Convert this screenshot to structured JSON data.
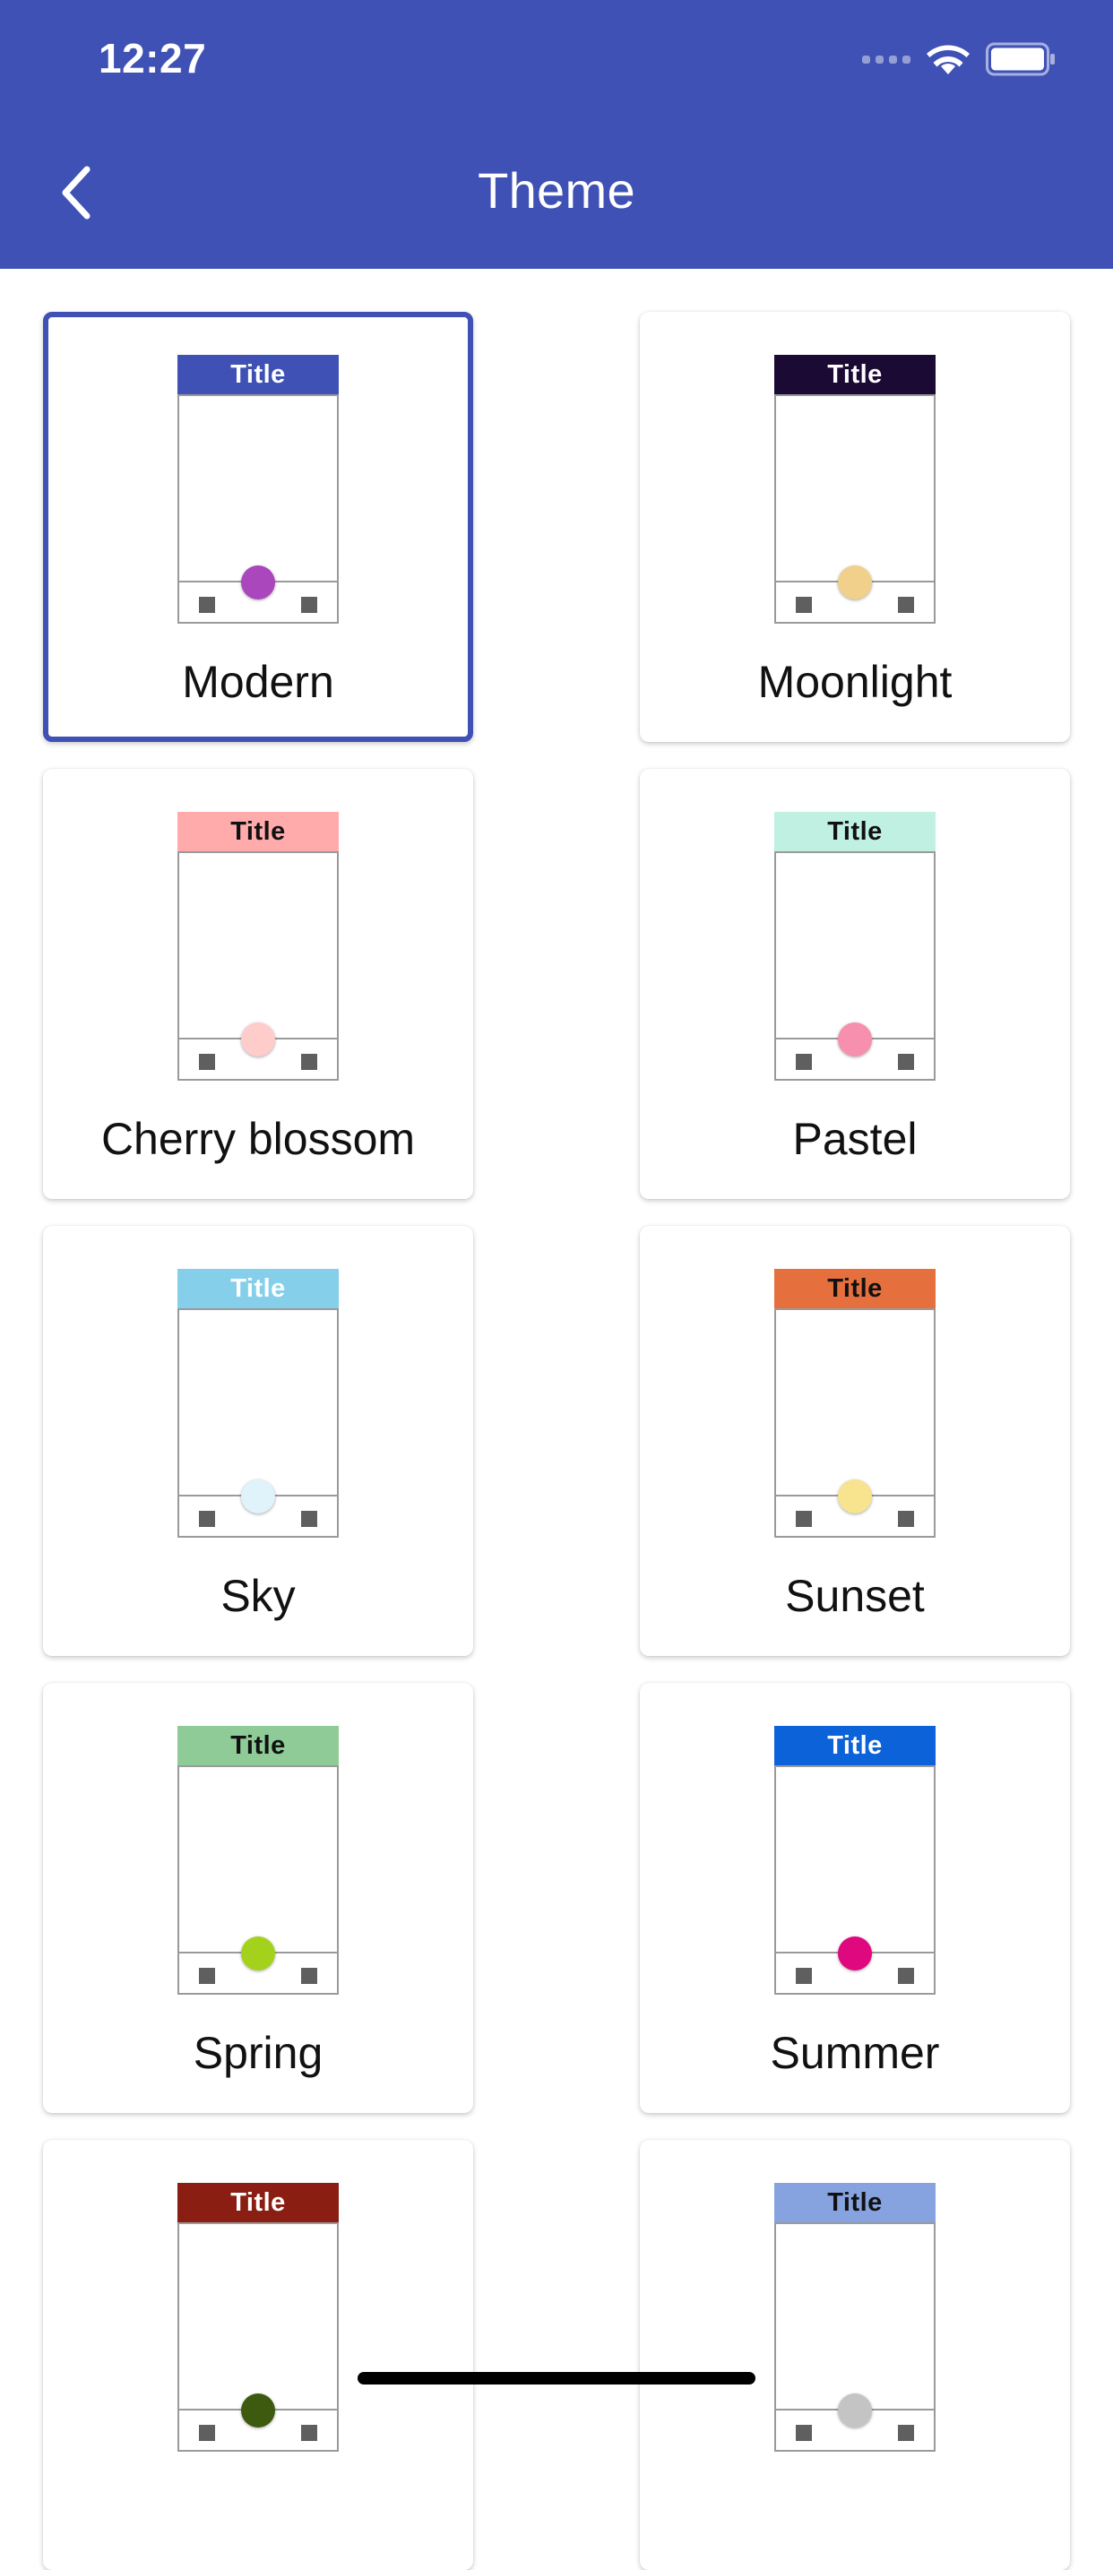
{
  "status_bar": {
    "time": "12:27"
  },
  "header": {
    "title": "Theme",
    "back_icon": "chevron-left-icon",
    "background": "#3f51b5"
  },
  "preview_label": "Title",
  "themes": [
    {
      "name": "Modern",
      "selected": true,
      "title_bg": "#3f51b5",
      "title_fg": "#ffffff",
      "fab": "#ab47bc"
    },
    {
      "name": "Moonlight",
      "selected": false,
      "title_bg": "#1b0a33",
      "title_fg": "#ffffff",
      "fab": "#f0d08a"
    },
    {
      "name": "Cherry blossom",
      "selected": false,
      "title_bg": "#ffabab",
      "title_fg": "#111111",
      "fab": "#ffcccc"
    },
    {
      "name": "Pastel",
      "selected": false,
      "title_bg": "#bff0e2",
      "title_fg": "#111111",
      "fab": "#f78fae"
    },
    {
      "name": "Sky",
      "selected": false,
      "title_bg": "#86cfeb",
      "title_fg": "#ffffff",
      "fab": "#e0f2fa"
    },
    {
      "name": "Sunset",
      "selected": false,
      "title_bg": "#e56f3d",
      "title_fg": "#111111",
      "fab": "#f8e38e"
    },
    {
      "name": "Spring",
      "selected": false,
      "title_bg": "#8ecb96",
      "title_fg": "#111111",
      "fab": "#a4d21c"
    },
    {
      "name": "Summer",
      "selected": false,
      "title_bg": "#0b62d9",
      "title_fg": "#ffffff",
      "fab": "#e0087e"
    },
    {
      "name": "",
      "selected": false,
      "title_bg": "#8a1e12",
      "title_fg": "#ffffff",
      "fab": "#3d5a0f"
    },
    {
      "name": "",
      "selected": false,
      "title_bg": "#86a3e0",
      "title_fg": "#111111",
      "fab": "#c4c4c4"
    }
  ]
}
